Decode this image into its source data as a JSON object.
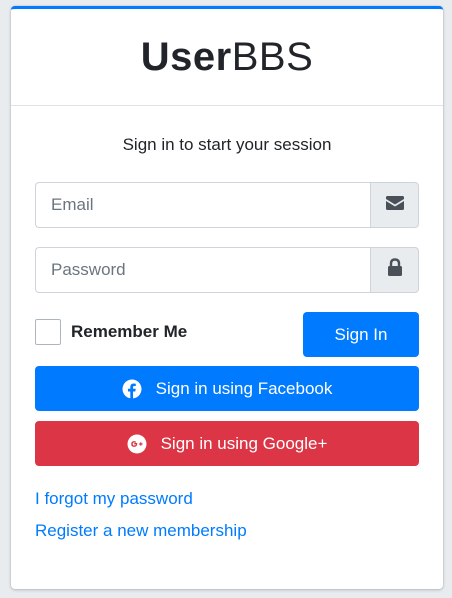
{
  "brand": {
    "bold": "User",
    "light": "BBS"
  },
  "login_message": "Sign in to start your session",
  "email": {
    "placeholder": "Email",
    "icon": "envelope-icon"
  },
  "password": {
    "placeholder": "Password",
    "icon": "lock-icon"
  },
  "remember_label": "Remember Me",
  "sign_in_label": "Sign In",
  "facebook": {
    "label": "Sign in using Facebook",
    "icon": "facebook-icon"
  },
  "google": {
    "label": "Sign in using Google+",
    "icon": "google-plus-icon"
  },
  "links": {
    "forgot": "I forgot my password",
    "register": "Register a new membership"
  },
  "colors": {
    "primary": "#007bff",
    "danger": "#dc3545",
    "background": "#e9ecef"
  }
}
